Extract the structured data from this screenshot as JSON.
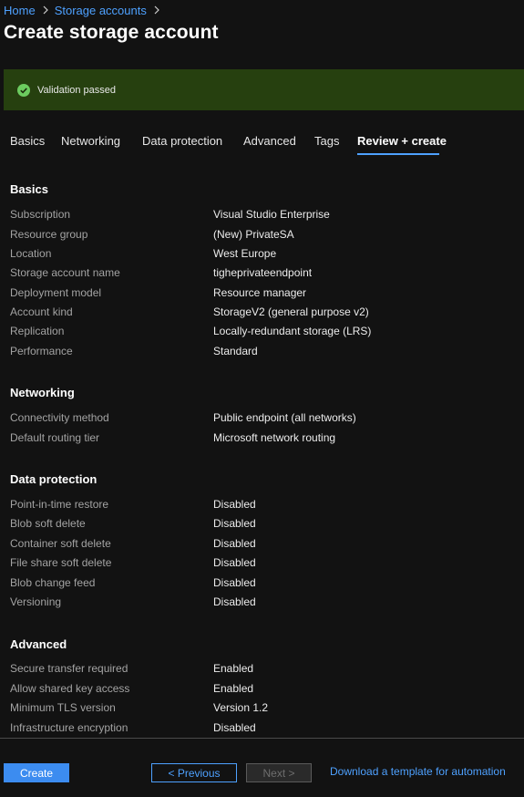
{
  "breadcrumb": {
    "home": "Home",
    "storage_accounts": "Storage accounts"
  },
  "page_title": "Create storage account",
  "validation": {
    "text": "Validation passed",
    "color": "#26400f"
  },
  "tabs": [
    {
      "label": "Basics"
    },
    {
      "label": "Networking"
    },
    {
      "label": "Data protection"
    },
    {
      "label": "Advanced"
    },
    {
      "label": "Tags"
    },
    {
      "label": "Review + create",
      "active": true
    }
  ],
  "sections": {
    "basics": {
      "title": "Basics",
      "rows": [
        {
          "label": "Subscription",
          "value": "Visual Studio Enterprise"
        },
        {
          "label": "Resource group",
          "value": "(New) PrivateSA"
        },
        {
          "label": "Location",
          "value": "West Europe"
        },
        {
          "label": "Storage account name",
          "value": "tigheprivateendpoint"
        },
        {
          "label": "Deployment model",
          "value": "Resource manager"
        },
        {
          "label": "Account kind",
          "value": "StorageV2 (general purpose v2)"
        },
        {
          "label": "Replication",
          "value": "Locally-redundant storage (LRS)"
        },
        {
          "label": "Performance",
          "value": "Standard"
        }
      ]
    },
    "networking": {
      "title": "Networking",
      "rows": [
        {
          "label": "Connectivity method",
          "value": "Public endpoint (all networks)"
        },
        {
          "label": "Default routing tier",
          "value": "Microsoft network routing"
        }
      ]
    },
    "data_protection": {
      "title": "Data protection",
      "rows": [
        {
          "label": "Point-in-time restore",
          "value": "Disabled"
        },
        {
          "label": "Blob soft delete",
          "value": "Disabled"
        },
        {
          "label": "Container soft delete",
          "value": "Disabled"
        },
        {
          "label": "File share soft delete",
          "value": "Disabled"
        },
        {
          "label": "Blob change feed",
          "value": "Disabled"
        },
        {
          "label": "Versioning",
          "value": "Disabled"
        }
      ]
    },
    "advanced": {
      "title": "Advanced",
      "rows": [
        {
          "label": "Secure transfer required",
          "value": "Enabled"
        },
        {
          "label": "Allow shared key access",
          "value": "Enabled"
        },
        {
          "label": "Minimum TLS version",
          "value": "Version 1.2"
        },
        {
          "label": "Infrastructure encryption",
          "value": "Disabled"
        }
      ]
    }
  },
  "footer": {
    "create_label": "Create",
    "previous_label": "< Previous",
    "next_label": "Next >",
    "download_label": "Download a template for automation"
  },
  "colors": {
    "accent": "#4ea1ff",
    "primary_button": "#3c8cf0",
    "background": "#121212",
    "success_icon": "#6ccb5f"
  }
}
